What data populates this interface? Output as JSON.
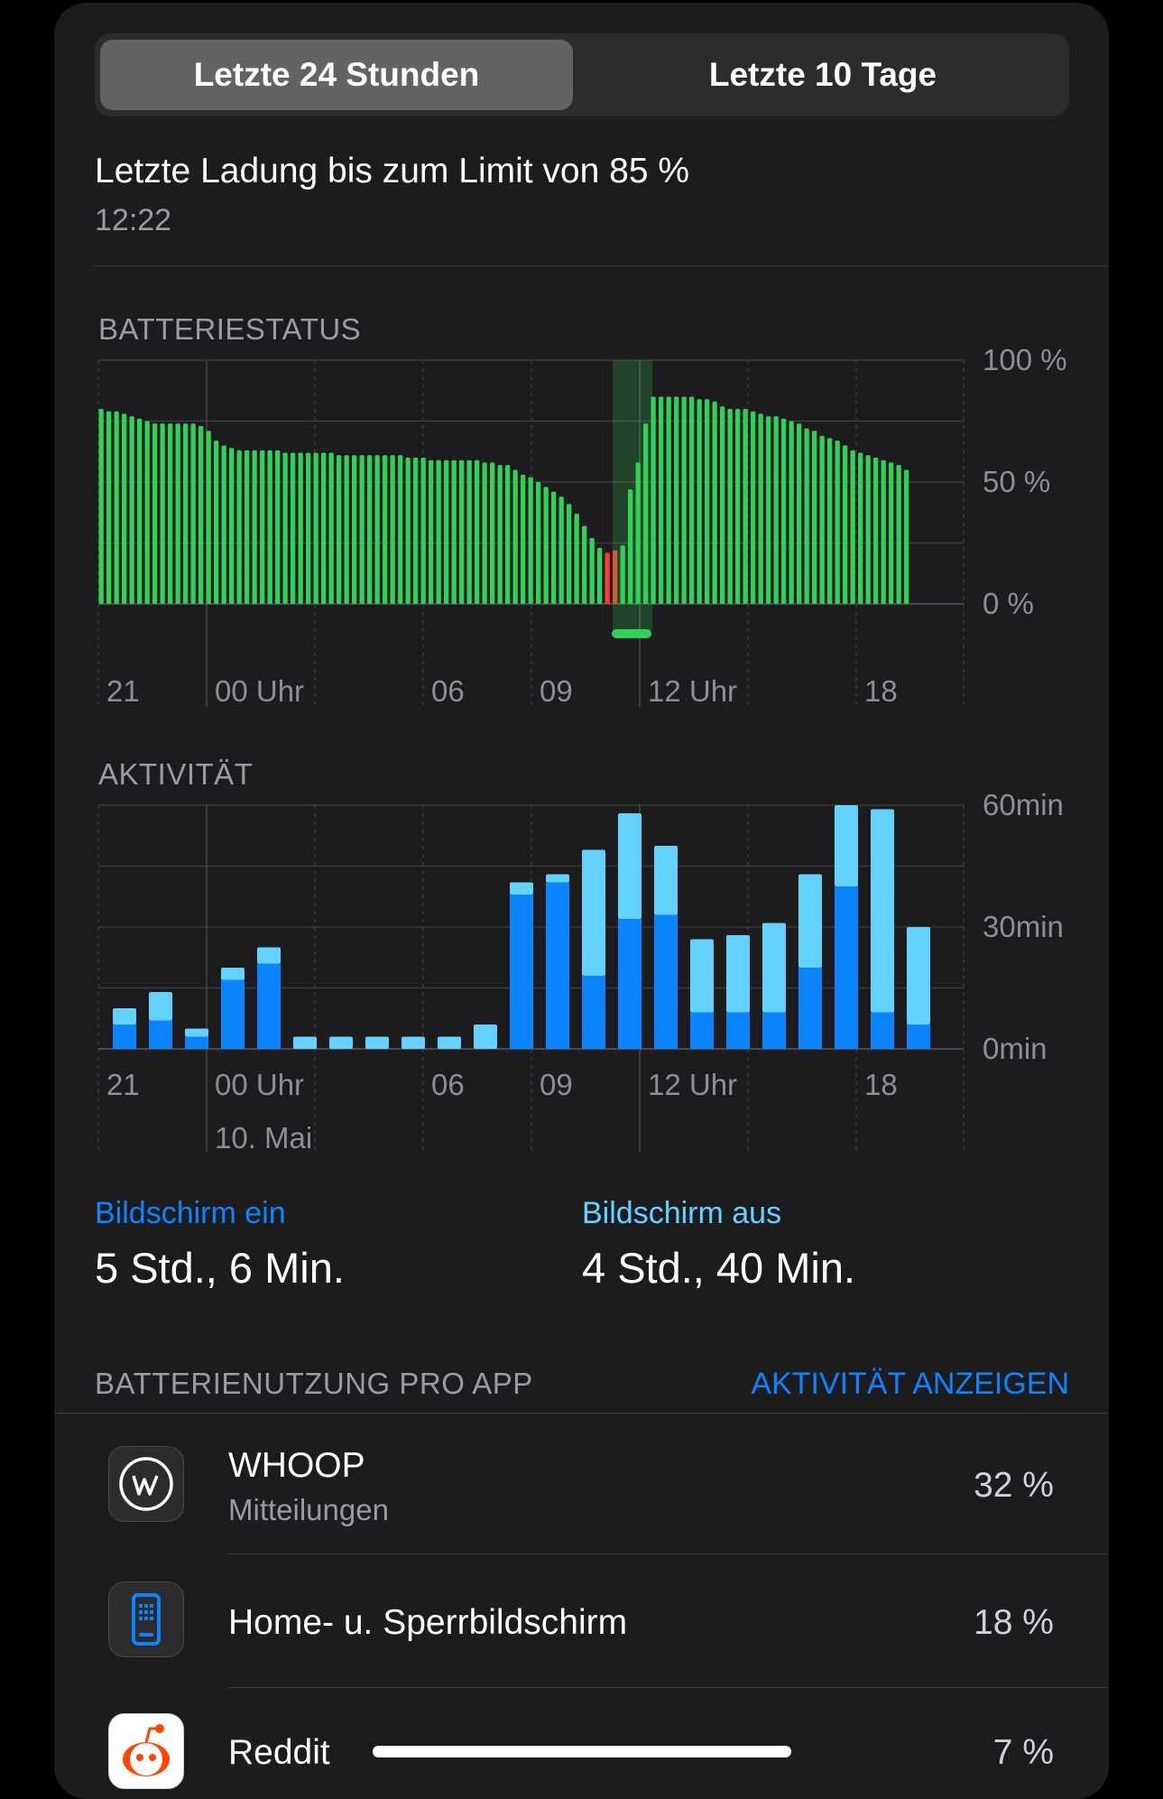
{
  "tabs": {
    "active": "Letzte 24 Stunden",
    "inactive": "Letzte 10 Tage"
  },
  "last_charge": {
    "title": "Letzte Ladung bis zum Limit von 85 %",
    "time": "12:22"
  },
  "battery": {
    "heading": "BATTERIESTATUS",
    "y_labels": [
      "100 %",
      "50 %",
      "0 %"
    ],
    "x_labels": [
      "21",
      "00 Uhr",
      "06",
      "09",
      "12 Uhr",
      "18"
    ]
  },
  "activity": {
    "heading": "AKTIVITÄT",
    "y_labels": [
      "60min",
      "30min",
      "0min"
    ],
    "x_labels": [
      "21",
      "00 Uhr",
      "06",
      "09",
      "12 Uhr",
      "18"
    ],
    "date_label": "10. Mai"
  },
  "screen": {
    "on_label": "Bildschirm ein",
    "on_value": "5 Std., 6 Min.",
    "off_label": "Bildschirm aus",
    "off_value": "4 Std., 40 Min."
  },
  "apps_header": {
    "title": "BATTERIENUTZUNG PRO APP",
    "action": "AKTIVITÄT ANZEIGEN"
  },
  "apps": [
    {
      "name": "WHOOP",
      "sub": "Mitteilungen",
      "pct": "32 %",
      "icon": "whoop-icon"
    },
    {
      "name": "Home- u. Sperrbildschirm",
      "pct": "18 %",
      "icon": "phone-screen-icon"
    },
    {
      "name": "Reddit",
      "pct": "7 %",
      "icon": "reddit-icon"
    }
  ],
  "colors": {
    "battery": "#30d158",
    "battery_low": "#ff3b30",
    "screen_on": "#0a84ff",
    "screen_off": "#64d2ff",
    "accent": "#0a84ff"
  },
  "chart_data": [
    {
      "type": "bar",
      "title": "BATTERIESTATUS",
      "ylim": [
        0,
        100
      ],
      "x_tick_labels": [
        "21",
        "00 Uhr",
        "06",
        "09",
        "12 Uhr",
        "18"
      ],
      "charging_marker": "12 Uhr",
      "series": [
        {
          "values": [
            80,
            79,
            79,
            78,
            77,
            76,
            75,
            74,
            74,
            74,
            74,
            74,
            74,
            73,
            71,
            67,
            65,
            64,
            63,
            63,
            63,
            63,
            63,
            63,
            62,
            62,
            62,
            62,
            62,
            62,
            62,
            61,
            61,
            61,
            61,
            61,
            61,
            61,
            61,
            61,
            60,
            60,
            60,
            59,
            59,
            59,
            59,
            59,
            59,
            59,
            58,
            58,
            57,
            57,
            55,
            53,
            52,
            50,
            48,
            46,
            44,
            41,
            37,
            32,
            27,
            23,
            21,
            22,
            24,
            47,
            58,
            74,
            85,
            85,
            85,
            85,
            85,
            85,
            84,
            84,
            83,
            81,
            80,
            80,
            80,
            79,
            78,
            77,
            77,
            76,
            75,
            74,
            72,
            71,
            69,
            68,
            67,
            65,
            63,
            62,
            61,
            60,
            59,
            58,
            57,
            55
          ]
        }
      ],
      "low_indices": [
        66,
        67
      ]
    },
    {
      "type": "bar",
      "title": "AKTIVITÄT",
      "ylim": [
        0,
        60
      ],
      "unit": "min",
      "x_tick_labels": [
        "21",
        "00 Uhr",
        "06",
        "09",
        "12 Uhr",
        "18"
      ],
      "series": [
        {
          "name": "Bildschirm ein",
          "values": [
            6,
            7,
            3,
            17,
            21,
            0,
            0,
            0,
            0,
            0,
            0,
            38,
            41,
            18,
            32,
            33,
            9,
            9,
            9,
            20,
            40,
            9,
            6
          ]
        },
        {
          "name": "Bildschirm aus",
          "values": [
            4,
            7,
            2,
            3,
            4,
            3,
            3,
            3,
            3,
            3,
            6,
            3,
            2,
            31,
            26,
            17,
            18,
            19,
            22,
            23,
            20,
            50,
            24
          ]
        }
      ]
    }
  ]
}
